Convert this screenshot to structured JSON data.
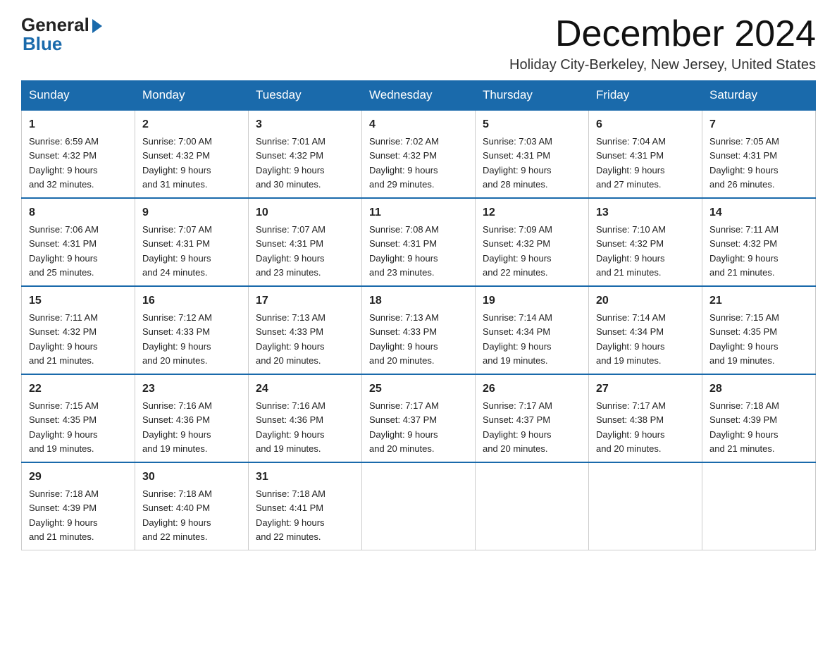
{
  "logo": {
    "general": "General",
    "blue": "Blue"
  },
  "header": {
    "month": "December 2024",
    "location": "Holiday City-Berkeley, New Jersey, United States"
  },
  "days_of_week": [
    "Sunday",
    "Monday",
    "Tuesday",
    "Wednesday",
    "Thursday",
    "Friday",
    "Saturday"
  ],
  "weeks": [
    [
      {
        "day": "1",
        "info": "Sunrise: 6:59 AM\nSunset: 4:32 PM\nDaylight: 9 hours\nand 32 minutes."
      },
      {
        "day": "2",
        "info": "Sunrise: 7:00 AM\nSunset: 4:32 PM\nDaylight: 9 hours\nand 31 minutes."
      },
      {
        "day": "3",
        "info": "Sunrise: 7:01 AM\nSunset: 4:32 PM\nDaylight: 9 hours\nand 30 minutes."
      },
      {
        "day": "4",
        "info": "Sunrise: 7:02 AM\nSunset: 4:32 PM\nDaylight: 9 hours\nand 29 minutes."
      },
      {
        "day": "5",
        "info": "Sunrise: 7:03 AM\nSunset: 4:31 PM\nDaylight: 9 hours\nand 28 minutes."
      },
      {
        "day": "6",
        "info": "Sunrise: 7:04 AM\nSunset: 4:31 PM\nDaylight: 9 hours\nand 27 minutes."
      },
      {
        "day": "7",
        "info": "Sunrise: 7:05 AM\nSunset: 4:31 PM\nDaylight: 9 hours\nand 26 minutes."
      }
    ],
    [
      {
        "day": "8",
        "info": "Sunrise: 7:06 AM\nSunset: 4:31 PM\nDaylight: 9 hours\nand 25 minutes."
      },
      {
        "day": "9",
        "info": "Sunrise: 7:07 AM\nSunset: 4:31 PM\nDaylight: 9 hours\nand 24 minutes."
      },
      {
        "day": "10",
        "info": "Sunrise: 7:07 AM\nSunset: 4:31 PM\nDaylight: 9 hours\nand 23 minutes."
      },
      {
        "day": "11",
        "info": "Sunrise: 7:08 AM\nSunset: 4:31 PM\nDaylight: 9 hours\nand 23 minutes."
      },
      {
        "day": "12",
        "info": "Sunrise: 7:09 AM\nSunset: 4:32 PM\nDaylight: 9 hours\nand 22 minutes."
      },
      {
        "day": "13",
        "info": "Sunrise: 7:10 AM\nSunset: 4:32 PM\nDaylight: 9 hours\nand 21 minutes."
      },
      {
        "day": "14",
        "info": "Sunrise: 7:11 AM\nSunset: 4:32 PM\nDaylight: 9 hours\nand 21 minutes."
      }
    ],
    [
      {
        "day": "15",
        "info": "Sunrise: 7:11 AM\nSunset: 4:32 PM\nDaylight: 9 hours\nand 21 minutes."
      },
      {
        "day": "16",
        "info": "Sunrise: 7:12 AM\nSunset: 4:33 PM\nDaylight: 9 hours\nand 20 minutes."
      },
      {
        "day": "17",
        "info": "Sunrise: 7:13 AM\nSunset: 4:33 PM\nDaylight: 9 hours\nand 20 minutes."
      },
      {
        "day": "18",
        "info": "Sunrise: 7:13 AM\nSunset: 4:33 PM\nDaylight: 9 hours\nand 20 minutes."
      },
      {
        "day": "19",
        "info": "Sunrise: 7:14 AM\nSunset: 4:34 PM\nDaylight: 9 hours\nand 19 minutes."
      },
      {
        "day": "20",
        "info": "Sunrise: 7:14 AM\nSunset: 4:34 PM\nDaylight: 9 hours\nand 19 minutes."
      },
      {
        "day": "21",
        "info": "Sunrise: 7:15 AM\nSunset: 4:35 PM\nDaylight: 9 hours\nand 19 minutes."
      }
    ],
    [
      {
        "day": "22",
        "info": "Sunrise: 7:15 AM\nSunset: 4:35 PM\nDaylight: 9 hours\nand 19 minutes."
      },
      {
        "day": "23",
        "info": "Sunrise: 7:16 AM\nSunset: 4:36 PM\nDaylight: 9 hours\nand 19 minutes."
      },
      {
        "day": "24",
        "info": "Sunrise: 7:16 AM\nSunset: 4:36 PM\nDaylight: 9 hours\nand 19 minutes."
      },
      {
        "day": "25",
        "info": "Sunrise: 7:17 AM\nSunset: 4:37 PM\nDaylight: 9 hours\nand 20 minutes."
      },
      {
        "day": "26",
        "info": "Sunrise: 7:17 AM\nSunset: 4:37 PM\nDaylight: 9 hours\nand 20 minutes."
      },
      {
        "day": "27",
        "info": "Sunrise: 7:17 AM\nSunset: 4:38 PM\nDaylight: 9 hours\nand 20 minutes."
      },
      {
        "day": "28",
        "info": "Sunrise: 7:18 AM\nSunset: 4:39 PM\nDaylight: 9 hours\nand 21 minutes."
      }
    ],
    [
      {
        "day": "29",
        "info": "Sunrise: 7:18 AM\nSunset: 4:39 PM\nDaylight: 9 hours\nand 21 minutes."
      },
      {
        "day": "30",
        "info": "Sunrise: 7:18 AM\nSunset: 4:40 PM\nDaylight: 9 hours\nand 22 minutes."
      },
      {
        "day": "31",
        "info": "Sunrise: 7:18 AM\nSunset: 4:41 PM\nDaylight: 9 hours\nand 22 minutes."
      },
      {
        "day": "",
        "info": ""
      },
      {
        "day": "",
        "info": ""
      },
      {
        "day": "",
        "info": ""
      },
      {
        "day": "",
        "info": ""
      }
    ]
  ]
}
